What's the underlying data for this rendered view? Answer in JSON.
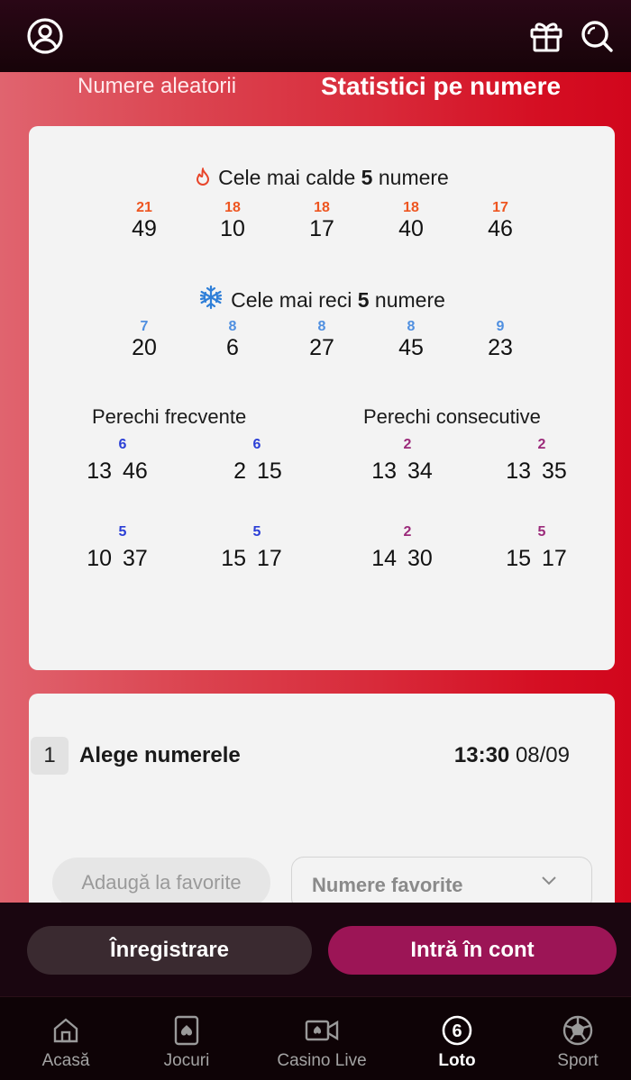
{
  "tabs": {
    "random_label": "Numere aleatorii",
    "stats_label": "Statistici pe numere"
  },
  "hot": {
    "prefix": "Cele mai calde",
    "count": "5",
    "suffix": "numere",
    "items": [
      {
        "count": "21",
        "number": "49"
      },
      {
        "count": "18",
        "number": "10"
      },
      {
        "count": "18",
        "number": "17"
      },
      {
        "count": "18",
        "number": "40"
      },
      {
        "count": "17",
        "number": "46"
      }
    ]
  },
  "cold": {
    "prefix": "Cele mai reci",
    "count": "5",
    "suffix": "numere",
    "items": [
      {
        "count": "7",
        "number": "20"
      },
      {
        "count": "8",
        "number": "6"
      },
      {
        "count": "8",
        "number": "27"
      },
      {
        "count": "8",
        "number": "45"
      },
      {
        "count": "9",
        "number": "23"
      }
    ]
  },
  "frequent_pairs": {
    "title": "Perechi frecvente",
    "items": [
      {
        "a": "13",
        "b": "46",
        "count": "6"
      },
      {
        "a": "2",
        "b": "15",
        "count": "6"
      },
      {
        "a": "10",
        "b": "37",
        "count": "5"
      },
      {
        "a": "15",
        "b": "17",
        "count": "5"
      }
    ]
  },
  "consecutive_pairs": {
    "title": "Perechi consecutive",
    "items": [
      {
        "a": "13",
        "b": "34",
        "count": "2"
      },
      {
        "a": "13",
        "b": "35",
        "count": "2"
      },
      {
        "a": "14",
        "b": "30",
        "count": "2"
      },
      {
        "a": "15",
        "b": "17",
        "count": "5"
      }
    ]
  },
  "pick": {
    "step": "1",
    "title": "Alege numerele",
    "time": "13:30",
    "date": "08/09",
    "add_favorite_label": "Adaugă la favorite",
    "favorites_select_value": "Numere favorite"
  },
  "actions": {
    "register_label": "Înregistrare",
    "login_label": "Intră în cont"
  },
  "nav": {
    "items": [
      {
        "label": "Acasă",
        "icon": "home-icon"
      },
      {
        "label": "Jocuri",
        "icon": "cards-icon"
      },
      {
        "label": "Casino Live",
        "icon": "live-camera-icon"
      },
      {
        "label": "Loto",
        "icon": "loto-ball-icon",
        "badge": "6"
      },
      {
        "label": "Sport",
        "icon": "soccer-ball-icon"
      }
    ],
    "active": "Loto"
  },
  "colors": {
    "hot_count": "#ee5520",
    "cold_count": "#4f8fe0",
    "freq_pair_count": "#2b3fd6",
    "cons_pair_count": "#9b2a7a",
    "login_button": "#9c1556",
    "register_button": "#3a2a30"
  }
}
